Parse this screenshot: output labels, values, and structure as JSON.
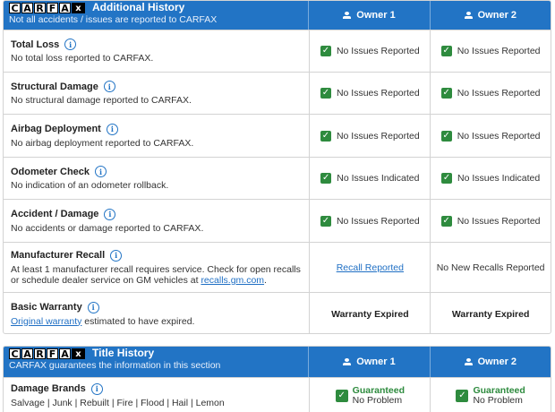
{
  "colors": {
    "header_blue": "#2274c5",
    "check_green": "#2e8b3e",
    "link_blue": "#1f6fc4"
  },
  "logo": {
    "letters": [
      "C",
      "A",
      "R",
      "F",
      "A",
      "x"
    ]
  },
  "additional": {
    "title": "Additional History",
    "subtitle": "Not all accidents / issues are reported to CARFAX",
    "owner1": "Owner 1",
    "owner2": "Owner 2",
    "rows": [
      {
        "title": "Total Loss",
        "desc": "No total loss reported to CARFAX.",
        "o1": "No Issues Reported",
        "o2": "No Issues Reported"
      },
      {
        "title": "Structural Damage",
        "desc": "No structural damage reported to CARFAX.",
        "o1": "No Issues Reported",
        "o2": "No Issues Reported"
      },
      {
        "title": "Airbag Deployment",
        "desc": "No airbag deployment reported to CARFAX.",
        "o1": "No Issues Reported",
        "o2": "No Issues Reported"
      },
      {
        "title": "Odometer Check",
        "desc": "No indication of an odometer rollback.",
        "o1": "No Issues Indicated",
        "o2": "No Issues Indicated"
      },
      {
        "title": "Accident / Damage",
        "desc": "No accidents or damage reported to CARFAX.",
        "o1": "No Issues Reported",
        "o2": "No Issues Reported"
      }
    ],
    "recall": {
      "title": "Manufacturer Recall",
      "desc_1": "At least 1 manufacturer recall requires service. Check for open recalls or schedule dealer service on GM vehicles at ",
      "desc_link": "recalls.gm.com",
      "desc_2": ".",
      "o1": "Recall Reported",
      "o2": "No New Recalls Reported"
    },
    "warranty": {
      "title": "Basic Warranty",
      "desc_link": "Original warranty",
      "desc_2": " estimated to have expired.",
      "o1": "Warranty Expired",
      "o2": "Warranty Expired"
    }
  },
  "title_history": {
    "title": "Title History",
    "subtitle": "CARFAX guarantees the information in this section",
    "owner1": "Owner 1",
    "owner2": "Owner 2",
    "row": {
      "title": "Damage Brands",
      "desc": "Salvage | Junk | Rebuilt | Fire | Flood | Hail | Lemon",
      "o1_top": "Guaranteed",
      "o1_bottom": "No Problem",
      "o2_top": "Guaranteed",
      "o2_bottom": "No Problem"
    }
  }
}
